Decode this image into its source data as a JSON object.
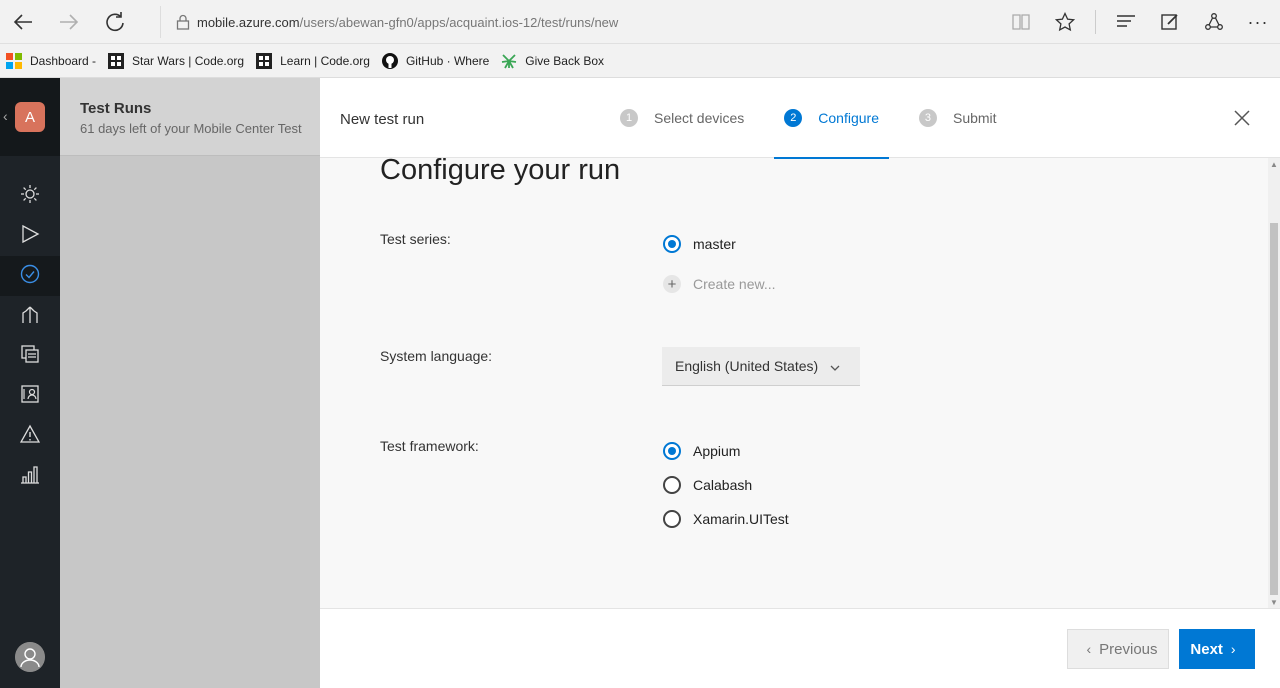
{
  "browser": {
    "url_host": "mobile.azure.com",
    "url_path": "/users/abewan-gfn0/apps/acquaint.ios-12/test/runs/new"
  },
  "favorites": [
    {
      "label": "Dashboard -",
      "icon": "windows-logo-icon"
    },
    {
      "label": "Star Wars | Code.org",
      "icon": "codeorg-icon"
    },
    {
      "label": "Learn | Code.org",
      "icon": "codeorg-icon"
    },
    {
      "label": "GitHub · Where",
      "icon": "github-icon"
    },
    {
      "label": "Give Back Box",
      "icon": "giveback-icon"
    }
  ],
  "app": {
    "avatar_letter": "A",
    "avatar_color": "#d8735c"
  },
  "bg_page": {
    "title": "Test Runs",
    "subtitle": "61 days left of your Mobile Center Test"
  },
  "modal": {
    "title": "New test run",
    "steps": [
      {
        "num": "1",
        "label": "Select devices",
        "active": false
      },
      {
        "num": "2",
        "label": "Configure",
        "active": true
      },
      {
        "num": "3",
        "label": "Submit",
        "active": false
      }
    ],
    "heading": "Configure your run",
    "test_series": {
      "label": "Test series:",
      "options": [
        {
          "label": "master",
          "checked": true
        }
      ],
      "create_new": "Create new..."
    },
    "system_language": {
      "label": "System language:",
      "selected": "English (United States)"
    },
    "test_framework": {
      "label": "Test framework:",
      "options": [
        {
          "label": "Appium",
          "checked": true
        },
        {
          "label": "Calabash",
          "checked": false
        },
        {
          "label": "Xamarin.UITest",
          "checked": false
        }
      ]
    },
    "footer": {
      "previous": "Previous",
      "next": "Next"
    }
  },
  "colors": {
    "accent": "#0078d4",
    "nav_bg": "#1e2328"
  }
}
